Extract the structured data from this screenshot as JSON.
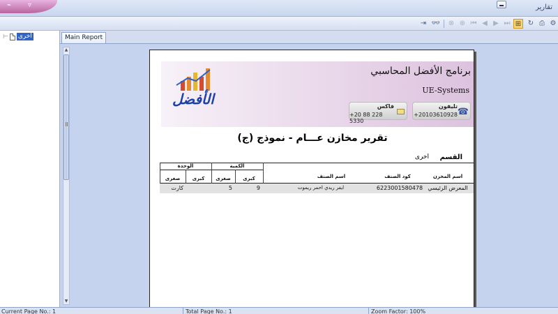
{
  "window": {
    "title": "تقارير"
  },
  "toolbar": {
    "buttons": [
      "export-icon",
      "find-icon",
      "binoculars-icon",
      "first-page-icon",
      "prev-page-icon",
      "next-page-icon",
      "last-page-icon",
      "goto-page-icon",
      "group-tree-icon",
      "refresh-icon",
      "print-icon",
      "print-setup-icon"
    ]
  },
  "tree": {
    "item": "اخرى"
  },
  "tabs": {
    "main": "Main Report"
  },
  "report": {
    "company_ar": "برنامج الأفضل المحاسبي",
    "company_en": "UE-Systems",
    "logo_text": "الأفضل",
    "phone_label": "تليفون",
    "phone_value": "+20103610928",
    "fax_label": "فاكس",
    "fax_value": "+20 88 228 5330",
    "title": "تقرير مخازن عـــام - نموذج (ج)",
    "dept_label": "القسم",
    "dept_value": "اخرى",
    "headers": {
      "store": "اسم المخزن",
      "code": "كود الصنف",
      "item": "اسم الصنف",
      "qty": "الكمية",
      "qty_big": "كبرى",
      "qty_small": "صغرى",
      "unit": "الوحدة",
      "unit_big": "كبرى",
      "unit_small": "صغرى"
    },
    "rows": [
      {
        "store": "المعرض الرئيسي",
        "code": "6223001580478",
        "item": "ايفر ريدي احمر ريموت",
        "qty_big": "9",
        "qty_small": "5",
        "unit_big": "",
        "unit_small": "كارت"
      }
    ]
  },
  "status": {
    "current_page": "Current Page No.: 1",
    "total_page": "Total Page No.: 1",
    "zoom": "Zoom Factor: 100%"
  }
}
